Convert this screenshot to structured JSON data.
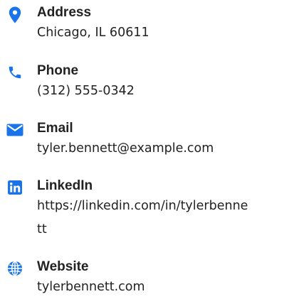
{
  "accent_color": "#1a73e8",
  "contacts": [
    {
      "label": "Address",
      "value": "Chicago, IL 60611",
      "icon": "map-pin-icon"
    },
    {
      "label": "Phone",
      "value": "(312) 555-0342",
      "icon": "phone-icon"
    },
    {
      "label": "Email",
      "value": "tyler.bennett@example.com",
      "icon": "envelope-icon"
    },
    {
      "label": "LinkedIn",
      "value": "https://linkedin.com/in/tylerbennett",
      "icon": "linkedin-icon"
    },
    {
      "label": "Website",
      "value": "tylerbennett.com",
      "icon": "globe-icon"
    }
  ]
}
